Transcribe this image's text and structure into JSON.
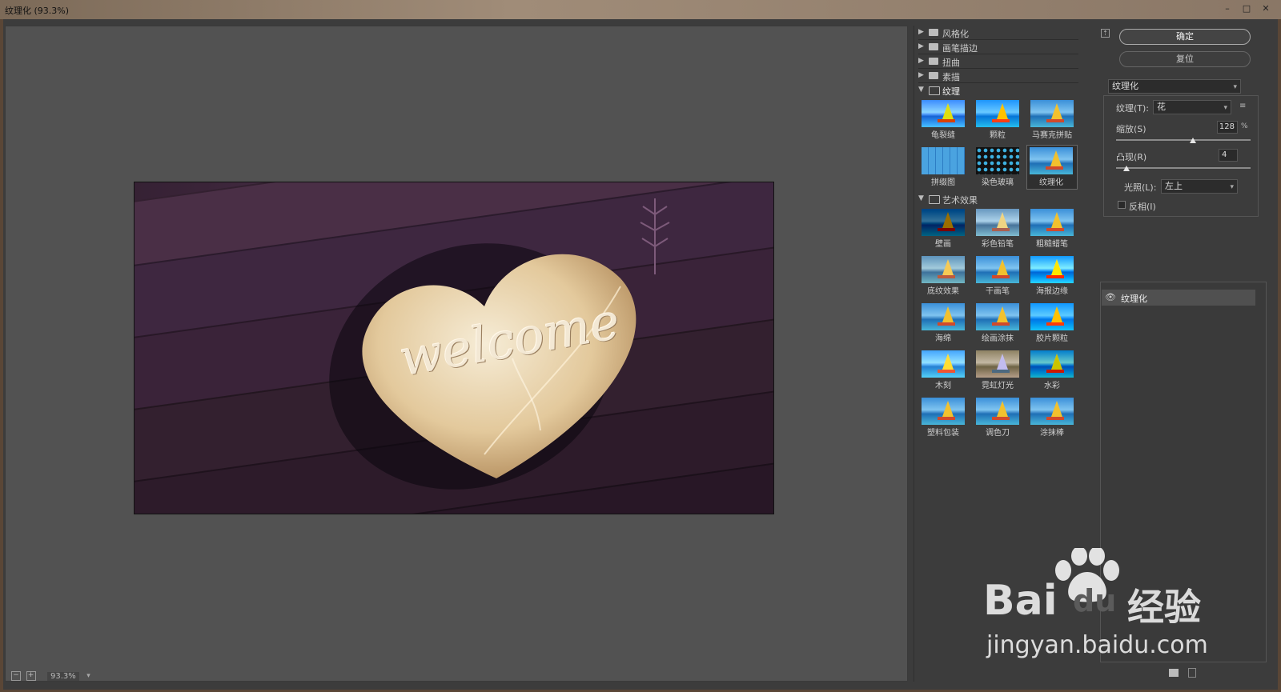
{
  "window": {
    "title": "纹理化 (93.3%)"
  },
  "status": {
    "zoom": "93.3%"
  },
  "photo": {
    "text": "welcome"
  },
  "filters": {
    "categories": [
      {
        "label": "风格化",
        "open": false
      },
      {
        "label": "画笔描边",
        "open": false
      },
      {
        "label": "扭曲",
        "open": false
      },
      {
        "label": "素描",
        "open": false
      },
      {
        "label": "纹理",
        "open": true
      },
      {
        "label": "艺术效果",
        "open": true
      }
    ],
    "texture_items": [
      "龟裂缝",
      "颗粒",
      "马赛克拼贴",
      "拼缀图",
      "染色玻璃",
      "纹理化"
    ],
    "art_items": [
      "壁画",
      "彩色铅笔",
      "粗糙蜡笔",
      "底纹效果",
      "干画笔",
      "海报边缘",
      "海绵",
      "绘画涂抹",
      "胶片颗粒",
      "木刻",
      "霓虹灯光",
      "水彩",
      "塑料包装",
      "调色刀",
      "涂抹棒"
    ],
    "selected": "纹理化"
  },
  "controls": {
    "ok": "确定",
    "reset": "复位",
    "filter_select": "纹理化",
    "texture_label": "纹理(T):",
    "texture_value": "花",
    "scale_label": "缩放(S)",
    "scale_value": "128",
    "scale_unit": "%",
    "scale_fraction": 0.57,
    "relief_label": "凸现(R)",
    "relief_value": "4",
    "relief_fraction": 0.08,
    "light_label": "光照(L):",
    "light_value": "左上",
    "invert_label": "反相(I)",
    "invert_checked": false
  },
  "layers": [
    {
      "name": "纹理化",
      "visible": true
    }
  ],
  "watermark": {
    "brand": "Bai",
    "paw": "du",
    "cn": "经验",
    "url": "jingyan.baidu.com"
  },
  "colors": {
    "panel": "#3c3c3c",
    "canvas": "#525252",
    "accent": "#505050"
  }
}
